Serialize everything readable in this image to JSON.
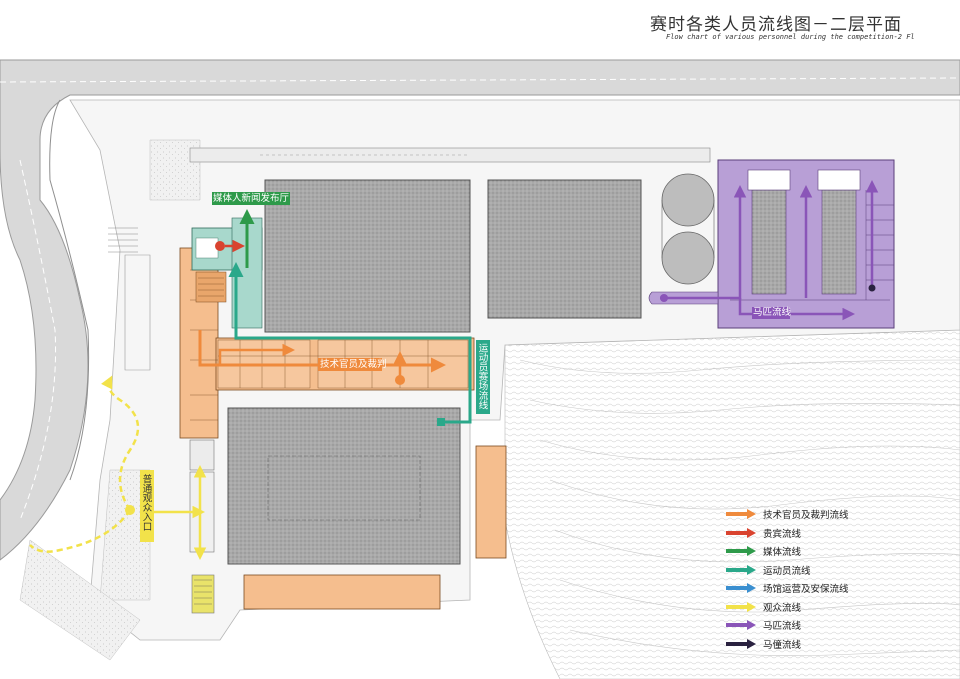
{
  "title": {
    "zh": "赛时各类人员流线图－二层平面",
    "en": "Flow chart of various personnel during the competition-2 Fl"
  },
  "legend": [
    {
      "label": "技术官员及裁判流线",
      "color": "#ef8a3c"
    },
    {
      "label": "贵宾流线",
      "color": "#d9432f"
    },
    {
      "label": "媒体流线",
      "color": "#2e9a4a"
    },
    {
      "label": "运动员流线",
      "color": "#2aa88a"
    },
    {
      "label": "场馆运营及安保流线",
      "color": "#3a8fd0"
    },
    {
      "label": "观众流线",
      "color": "#f2e24a"
    },
    {
      "label": "马匹流线",
      "color": "#8a55b8"
    },
    {
      "label": "马僮流线",
      "color": "#2a2240"
    }
  ],
  "route_labels": {
    "media": "媒体人新闻发布厅",
    "tech": "技术官员及裁判",
    "athlete": "运动员赛场流线",
    "horse": "马匹流线",
    "spectator": "普通观众入口"
  }
}
